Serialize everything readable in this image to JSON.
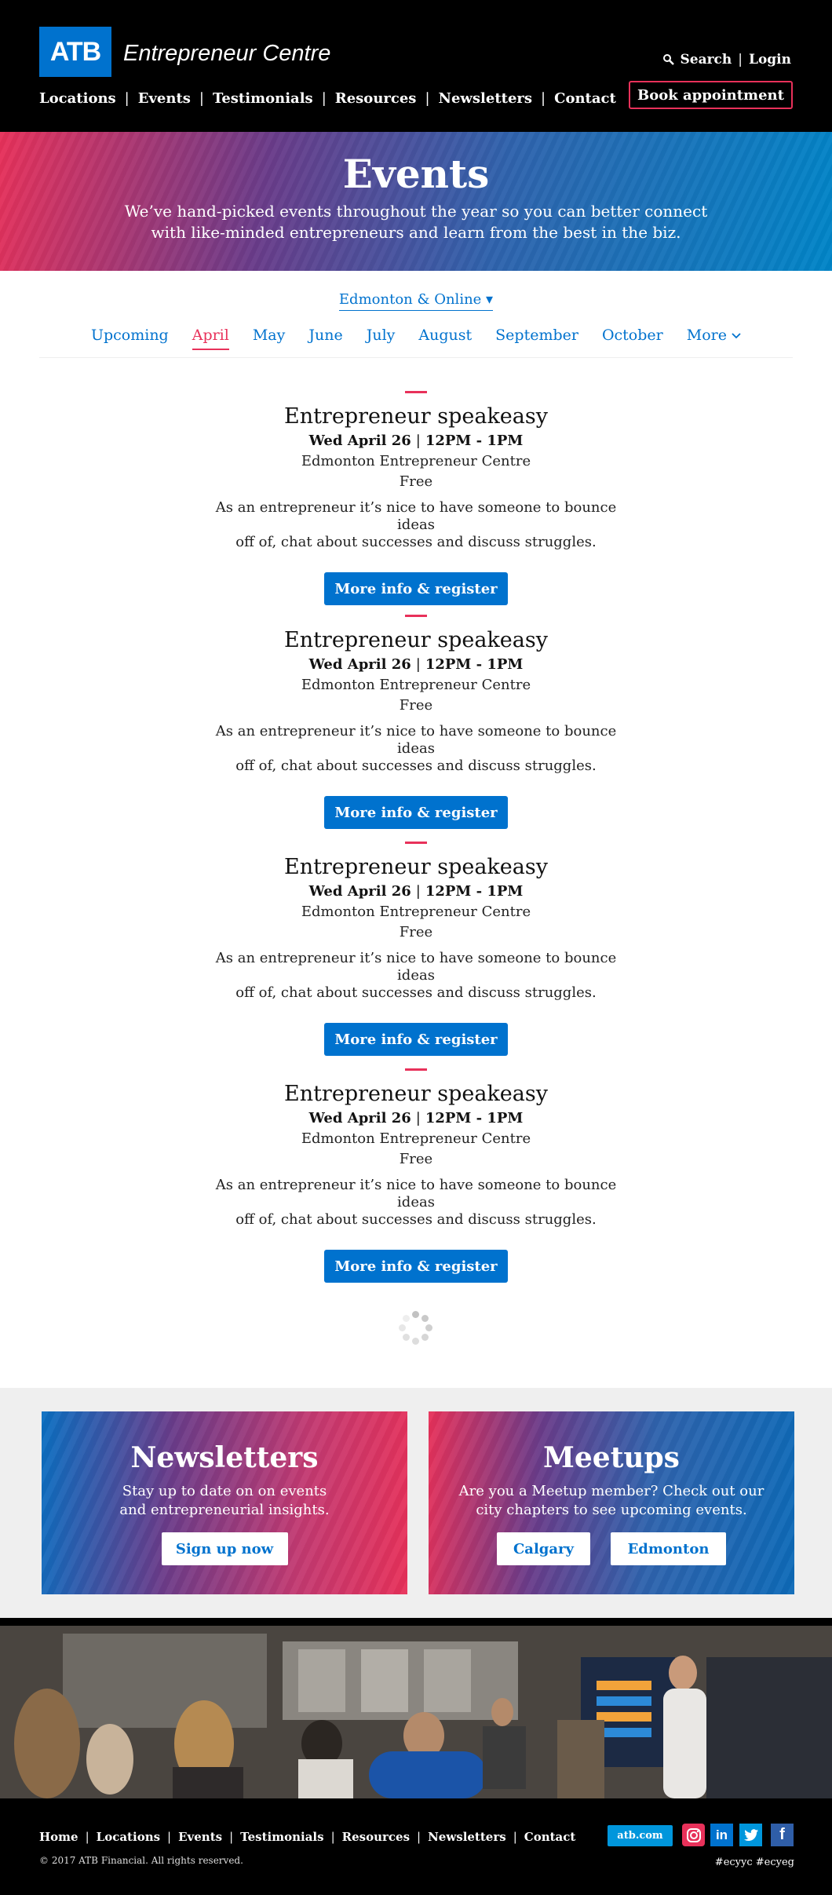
{
  "header": {
    "logo": "ATB",
    "brand": "Entrepreneur Centre",
    "nav": [
      "Locations",
      "Events",
      "Testimonials",
      "Resources",
      "Newsletters",
      "Contact"
    ],
    "search": "Search",
    "login": "Login",
    "book": "Book appointment"
  },
  "hero": {
    "title": "Events",
    "line1": "We’ve hand-picked events throughout the year so you can better connect",
    "line2": "with like-minded entrepreneurs and learn from the best in the biz."
  },
  "filters": {
    "location": "Edmonton & Online ▾",
    "months": [
      "Upcoming",
      "April",
      "May",
      "June",
      "July",
      "August",
      "September",
      "October",
      "More"
    ],
    "active_month": "April"
  },
  "events": [
    {
      "title": "Entrepreneur speakeasy",
      "date": "Wed April 26",
      "time": "12PM - 1PM",
      "location": "Edmonton Entrepreneur Centre",
      "price": "Free",
      "desc1": "As an entrepreneur it’s nice to have someone to bounce ideas",
      "desc2": "off of, chat about successes and discuss struggles.",
      "button": "More info & register"
    },
    {
      "title": "Entrepreneur speakeasy",
      "date": "Wed April 26",
      "time": "12PM - 1PM",
      "location": "Edmonton Entrepreneur Centre",
      "price": "Free",
      "desc1": "As an entrepreneur it’s nice to have someone to bounce ideas",
      "desc2": "off of, chat about successes and discuss struggles.",
      "button": "More info & register"
    },
    {
      "title": "Entrepreneur speakeasy",
      "date": "Wed April 26",
      "time": "12PM - 1PM",
      "location": "Edmonton Entrepreneur Centre",
      "price": "Free",
      "desc1": "As an entrepreneur it’s nice to have someone to bounce ideas",
      "desc2": "off of, chat about successes and discuss struggles.",
      "button": "More info & register"
    },
    {
      "title": "Entrepreneur speakeasy",
      "date": "Wed April 26",
      "time": "12PM - 1PM",
      "location": "Edmonton Entrepreneur Centre",
      "price": "Free",
      "desc1": "As an entrepreneur it’s nice to have someone to bounce ideas",
      "desc2": "off of, chat about successes and discuss struggles.",
      "button": "More info & register"
    }
  ],
  "promo": {
    "newsletters": {
      "title": "Newsletters",
      "line1": "Stay up to date on on events",
      "line2": "and entrepreneurial insights.",
      "button": "Sign up now"
    },
    "meetups": {
      "title": "Meetups",
      "line1": "Are you a Meetup member? Check out our",
      "line2": "city chapters to see upcoming events.",
      "button1": "Calgary",
      "button2": "Edmonton"
    }
  },
  "footer": {
    "nav": [
      "Home",
      "Locations",
      "Events",
      "Testimonials",
      "Resources",
      "Newsletters",
      "Contact"
    ],
    "copyright": "© 2017 ATB Financial. All rights reserved.",
    "atb_link": "atb.com",
    "hashtags": "#ecyyc  #ecyeg"
  },
  "colors": {
    "brand_blue": "#0072ce",
    "accent_pink": "#e8315a",
    "header_bg": "#000000"
  }
}
